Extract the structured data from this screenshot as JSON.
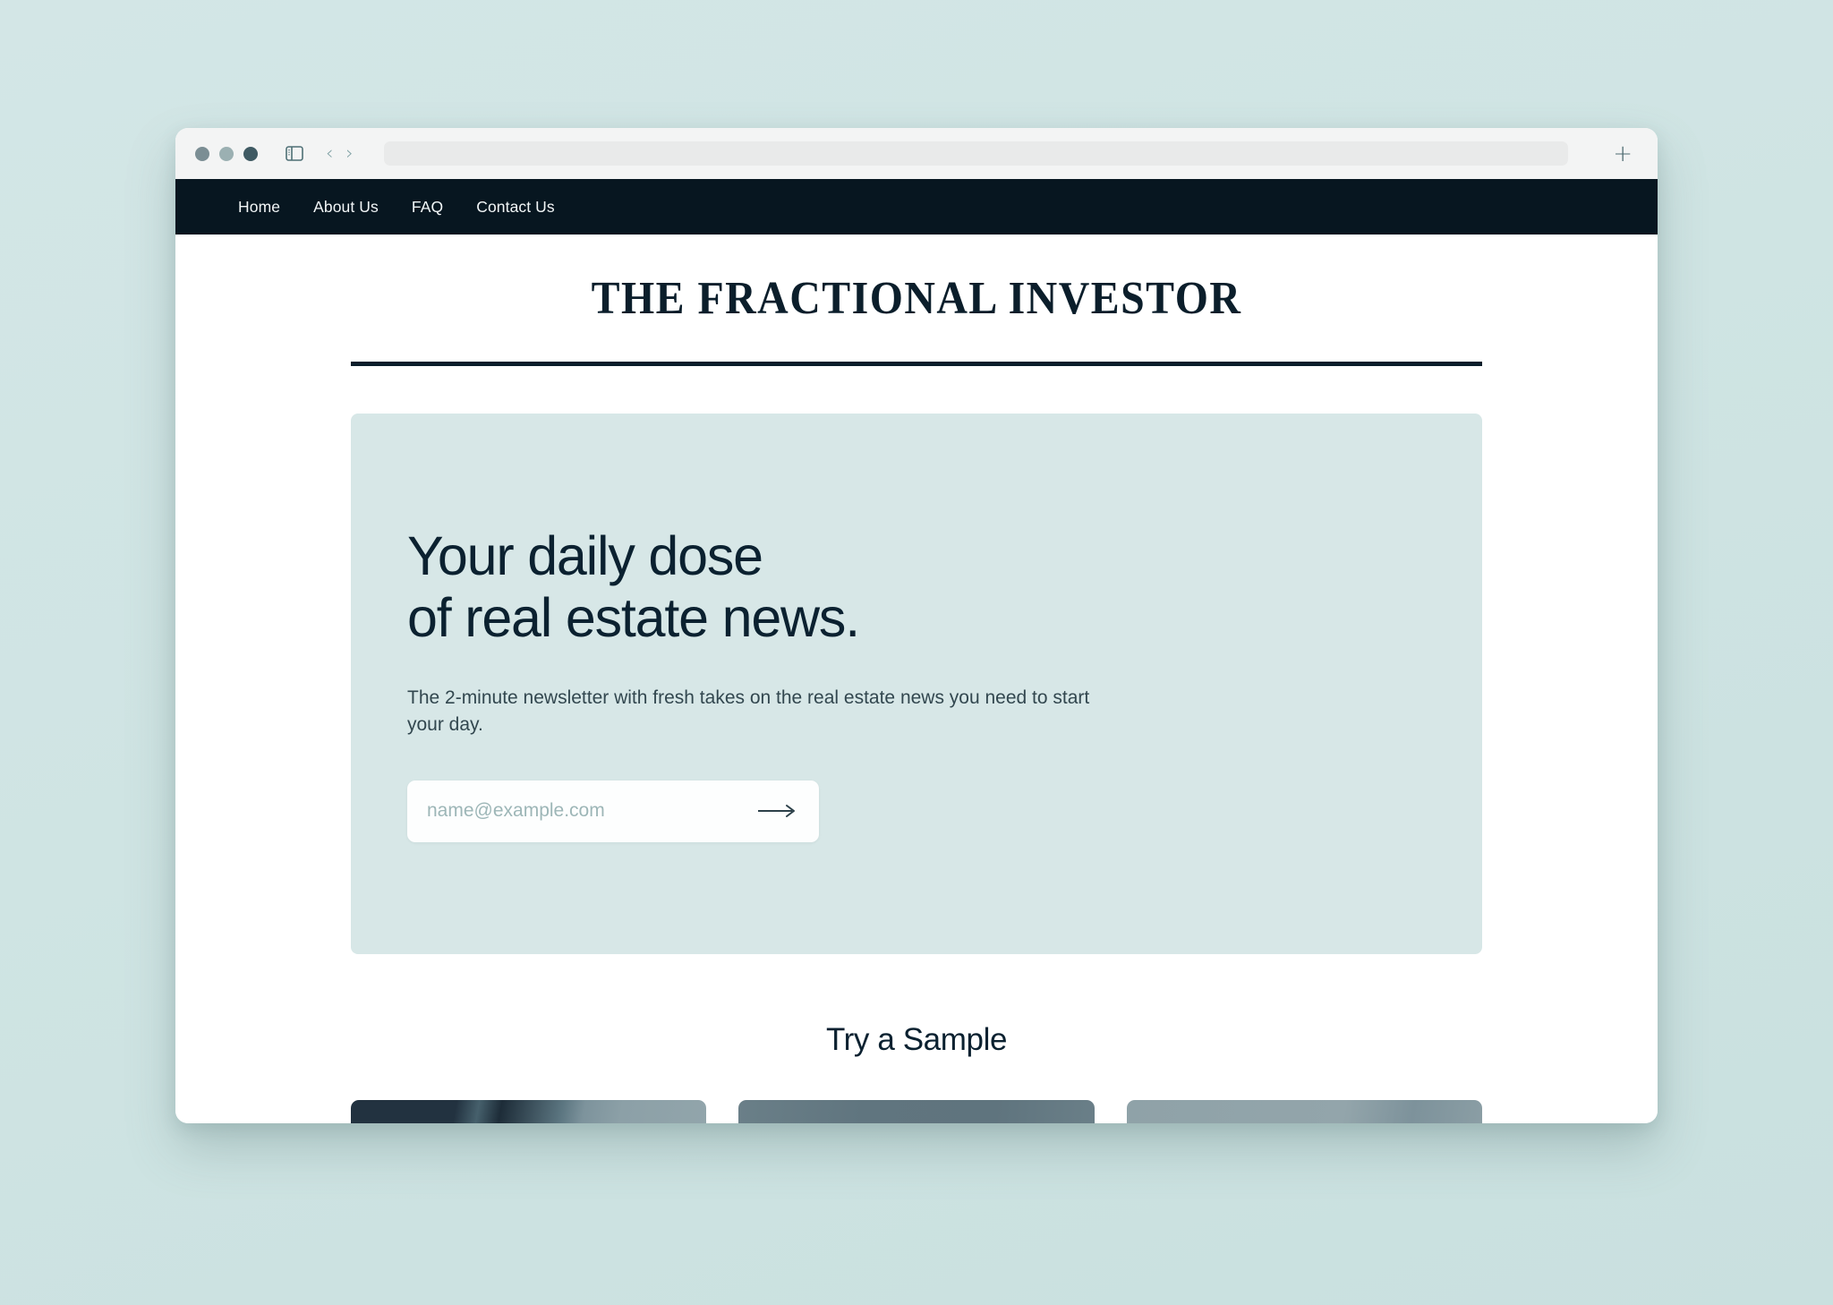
{
  "browser": {
    "traffic_lights": [
      "close",
      "minimize",
      "maximize"
    ],
    "sidebar_toggle_icon": "sidebar-toggle-icon",
    "back_label": "‹",
    "forward_label": "›",
    "address_value": "",
    "address_placeholder": "",
    "new_tab_label": "+"
  },
  "site_nav": {
    "items": [
      {
        "label": "Home"
      },
      {
        "label": "About Us"
      },
      {
        "label": "FAQ"
      },
      {
        "label": "Contact Us"
      }
    ]
  },
  "masthead": {
    "title": "THE FRACTIONAL INVESTOR"
  },
  "hero": {
    "heading_line1": "Your daily dose",
    "heading_line2": "of real estate news.",
    "subtext": "The 2-minute newsletter with fresh takes on the real estate news you need to start your day.",
    "email_placeholder": "name@example.com",
    "email_value": "",
    "submit_icon": "arrow-right-icon"
  },
  "sample": {
    "heading": "Try a Sample",
    "cards": [
      {
        "name": "sample-card-1"
      },
      {
        "name": "sample-card-2"
      },
      {
        "name": "sample-card-3"
      }
    ]
  },
  "colors": {
    "page_background": "#cfe4e3",
    "nav_background": "#071620",
    "hero_background": "#d7e7e7",
    "text_dark": "#0b2130",
    "rule": "#0b1e2b"
  }
}
